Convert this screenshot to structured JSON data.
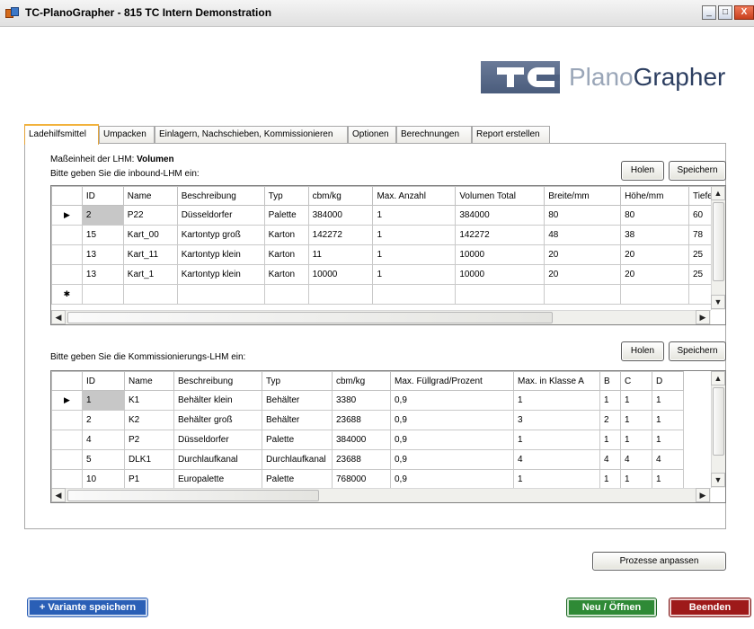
{
  "window": {
    "title": "TC-PlanoGrapher - 815 TC Intern Demonstration",
    "minimize_glyph": "_",
    "maximize_glyph": "□",
    "close_glyph": "X"
  },
  "logo": {
    "part1": "Plano",
    "part2": "Grapher"
  },
  "tabs": [
    {
      "label": "Ladehilfsmittel",
      "active": true
    },
    {
      "label": "Umpacken"
    },
    {
      "label": "Einlagern, Nachschieben, Kommissionieren"
    },
    {
      "label": "Optionen"
    },
    {
      "label": "Berechnungen"
    },
    {
      "label": "Report erstellen"
    }
  ],
  "unit": {
    "label": "Maßeinheit der LHM:",
    "value": "Volumen"
  },
  "inbound": {
    "prompt": "Bitte geben Sie die inbound-LHM ein:",
    "holen_label": "Holen",
    "speichern_label": "Speichern",
    "columns": [
      "ID",
      "Name",
      "Beschreibung",
      "Typ",
      "cbm/kg",
      "Max. Anzahl",
      "Volumen Total",
      "Breite/mm",
      "Höhe/mm",
      "Tiefe"
    ],
    "rows": [
      [
        "2",
        "P22",
        "Düsseldorfer",
        "Palette",
        "384000",
        "1",
        "384000",
        "80",
        "80",
        "60"
      ],
      [
        "15",
        "Kart_00",
        "Kartontyp groß",
        "Karton",
        "142272",
        "1",
        "142272",
        "48",
        "38",
        "78"
      ],
      [
        "13",
        "Kart_11",
        "Kartontyp klein",
        "Karton",
        "11",
        "1",
        "10000",
        "20",
        "20",
        "25"
      ],
      [
        "13",
        "Kart_1",
        "Kartontyp klein",
        "Karton",
        "10000",
        "1",
        "10000",
        "20",
        "20",
        "25"
      ]
    ],
    "current_row_marker": "▶",
    "new_row_marker": "✱"
  },
  "kommission": {
    "prompt": "Bitte geben Sie die Kommissionierungs-LHM ein:",
    "holen_label": "Holen",
    "speichern_label": "Speichern",
    "columns": [
      "ID",
      "Name",
      "Beschreibung",
      "Typ",
      "cbm/kg",
      "Max. Füllgrad/Prozent",
      "Max. in Klasse A",
      "B",
      "C",
      "D"
    ],
    "rows": [
      [
        "1",
        "K1",
        "Behälter klein",
        "Behälter",
        "3380",
        "0,9",
        "1",
        "1",
        "1",
        "1"
      ],
      [
        "2",
        "K2",
        "Behälter groß",
        "Behälter",
        "23688",
        "0,9",
        "3",
        "2",
        "1",
        "1"
      ],
      [
        "4",
        "P2",
        "Düsseldorfer",
        "Palette",
        "384000",
        "0,9",
        "1",
        "1",
        "1",
        "1"
      ],
      [
        "5",
        "DLK1",
        "Durchlaufkanal",
        "Durchlaufkanal",
        "23688",
        "0,9",
        "4",
        "4",
        "4",
        "4"
      ],
      [
        "10",
        "P1",
        "Europalette",
        "Palette",
        "768000",
        "0,9",
        "1",
        "1",
        "1",
        "1"
      ]
    ],
    "current_row_marker": "▶"
  },
  "prozesse_label": "Prozesse anpassen",
  "footer": {
    "variante_label": "+ Variante speichern",
    "neu_label": "Neu / Öffnen",
    "beenden_label": "Beenden"
  }
}
